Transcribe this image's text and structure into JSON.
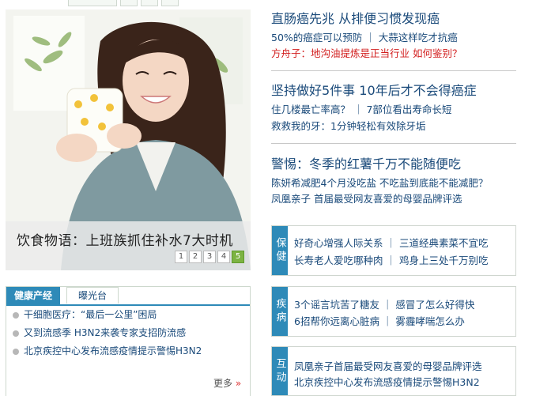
{
  "slideshow": {
    "caption": "饮食物语：上班族抓住补水7大时机",
    "pages": [
      "1",
      "2",
      "3",
      "4",
      "5"
    ],
    "active_page": 5
  },
  "left_tabs": {
    "tabs": [
      "健康产经",
      "曝光台"
    ],
    "active_tab": "健康产经",
    "items": [
      "干细胞医疗：“最后一公里”困局",
      "又到流感季 H3N2来袭专家支招防流感",
      "北京疾控中心发布流感疫情提示警惕H3N2"
    ],
    "more_label": "更多",
    "more_arrow": "»"
  },
  "news_groups": [
    {
      "headline": "直肠癌先兆 从排便习惯发现癌",
      "lines": [
        {
          "text": "50%的癌症可以预防 ｜ 大蒜这样吃才抗癌",
          "color": "#1a4a7a"
        },
        {
          "text": "方舟子：地沟油提炼是正当行业 如何鉴别？",
          "color": "#d21e1e"
        }
      ]
    },
    {
      "headline": "坚持做好5件事 10年后才不会得癌症",
      "lines": [
        {
          "text": "住几楼最亡率高？ ｜ 7部位看出寿命长短",
          "color": "#1a4a7a"
        },
        {
          "text": "救救我的牙：1分钟轻松有效除牙垢",
          "color": "#1a4a7a"
        }
      ]
    },
    {
      "headline": "警惕：冬季的红薯千万不能随便吃",
      "lines": [
        {
          "text": "陈妍希减肥4个月没吃盐 不吃盐到底能不能减肥？",
          "color": "#1a4a7a"
        },
        {
          "text": "凤凰亲子 首届最受网友喜爱的母婴品牌评选",
          "color": "#1a4a7a"
        }
      ]
    }
  ],
  "categories": [
    {
      "label": "保健",
      "rows": [
        "好奇心增强人际关系 ｜ 三道经典素菜不宜吃",
        "长寿老人爱吃哪种肉 ｜ 鸡身上三处千万别吃"
      ]
    },
    {
      "label": "疾病",
      "rows": [
        "3个谣言坑苦了糖友 ｜ 感冒了怎么好得快",
        "6招帮你远离心脏病 ｜ 雾霾哮喘怎么办"
      ]
    },
    {
      "label": "互动",
      "rows": [
        "凤凰亲子首届最受网友喜爱的母婴品牌评选",
        "北京疾控中心发布流感疫情提示警惕H3N2"
      ]
    }
  ],
  "colors": {
    "accent": "#2e8ab8",
    "link": "#1a4a7a",
    "alert": "#d21e1e",
    "pager_active": "#7cb342"
  }
}
